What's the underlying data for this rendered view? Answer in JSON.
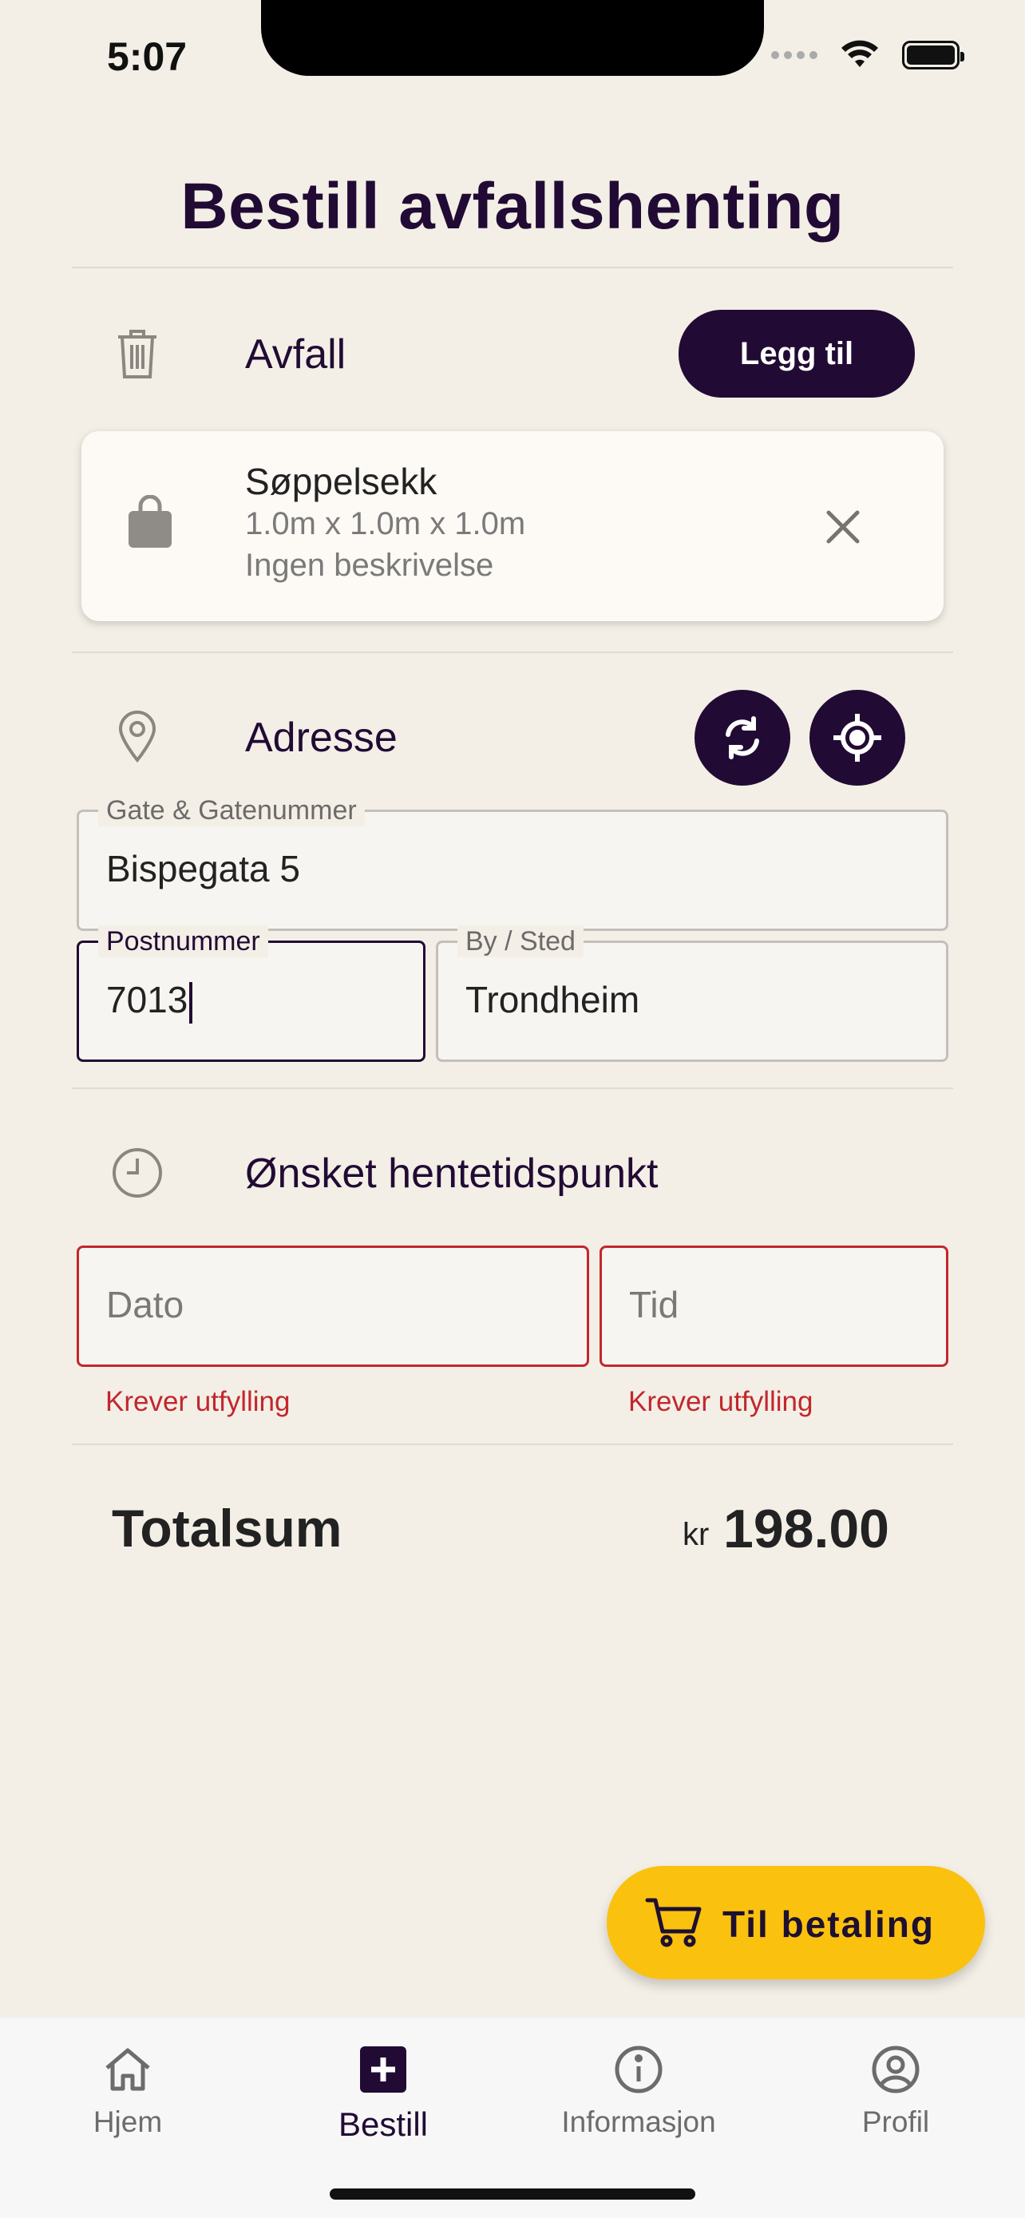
{
  "status_bar": {
    "time": "5:07"
  },
  "page": {
    "title": "Bestill avfallshenting"
  },
  "waste": {
    "title": "Avfall",
    "add_button": "Legg til",
    "items": [
      {
        "name": "Søppelsekk",
        "dimensions": "1.0m x 1.0m x 1.0m",
        "description": "Ingen beskrivelse"
      }
    ]
  },
  "address": {
    "title": "Adresse",
    "street": {
      "label": "Gate & Gatenummer",
      "value": "Bispegata 5"
    },
    "postal": {
      "label": "Postnummer",
      "value": "7013"
    },
    "city": {
      "label": "By / Sted",
      "value": "Trondheim"
    }
  },
  "pickup": {
    "title": "Ønsket hentetidspunkt",
    "date": {
      "placeholder": "Dato",
      "error": "Krever utfylling"
    },
    "time": {
      "placeholder": "Tid",
      "error": "Krever utfylling"
    }
  },
  "total": {
    "label": "Totalsum",
    "currency": "kr",
    "amount": "198.00"
  },
  "checkout": {
    "label": "Til betaling"
  },
  "tabbar": {
    "items": [
      {
        "label": "Hjem",
        "icon": "home-icon"
      },
      {
        "label": "Bestill",
        "icon": "plus-square-icon",
        "active": true
      },
      {
        "label": "Informasjon",
        "icon": "info-icon"
      },
      {
        "label": "Profil",
        "icon": "user-circle-icon"
      }
    ]
  },
  "colors": {
    "primary": "#210b34",
    "accent": "#fbc10f",
    "error": "#c2272d",
    "background": "#f3efe6"
  }
}
